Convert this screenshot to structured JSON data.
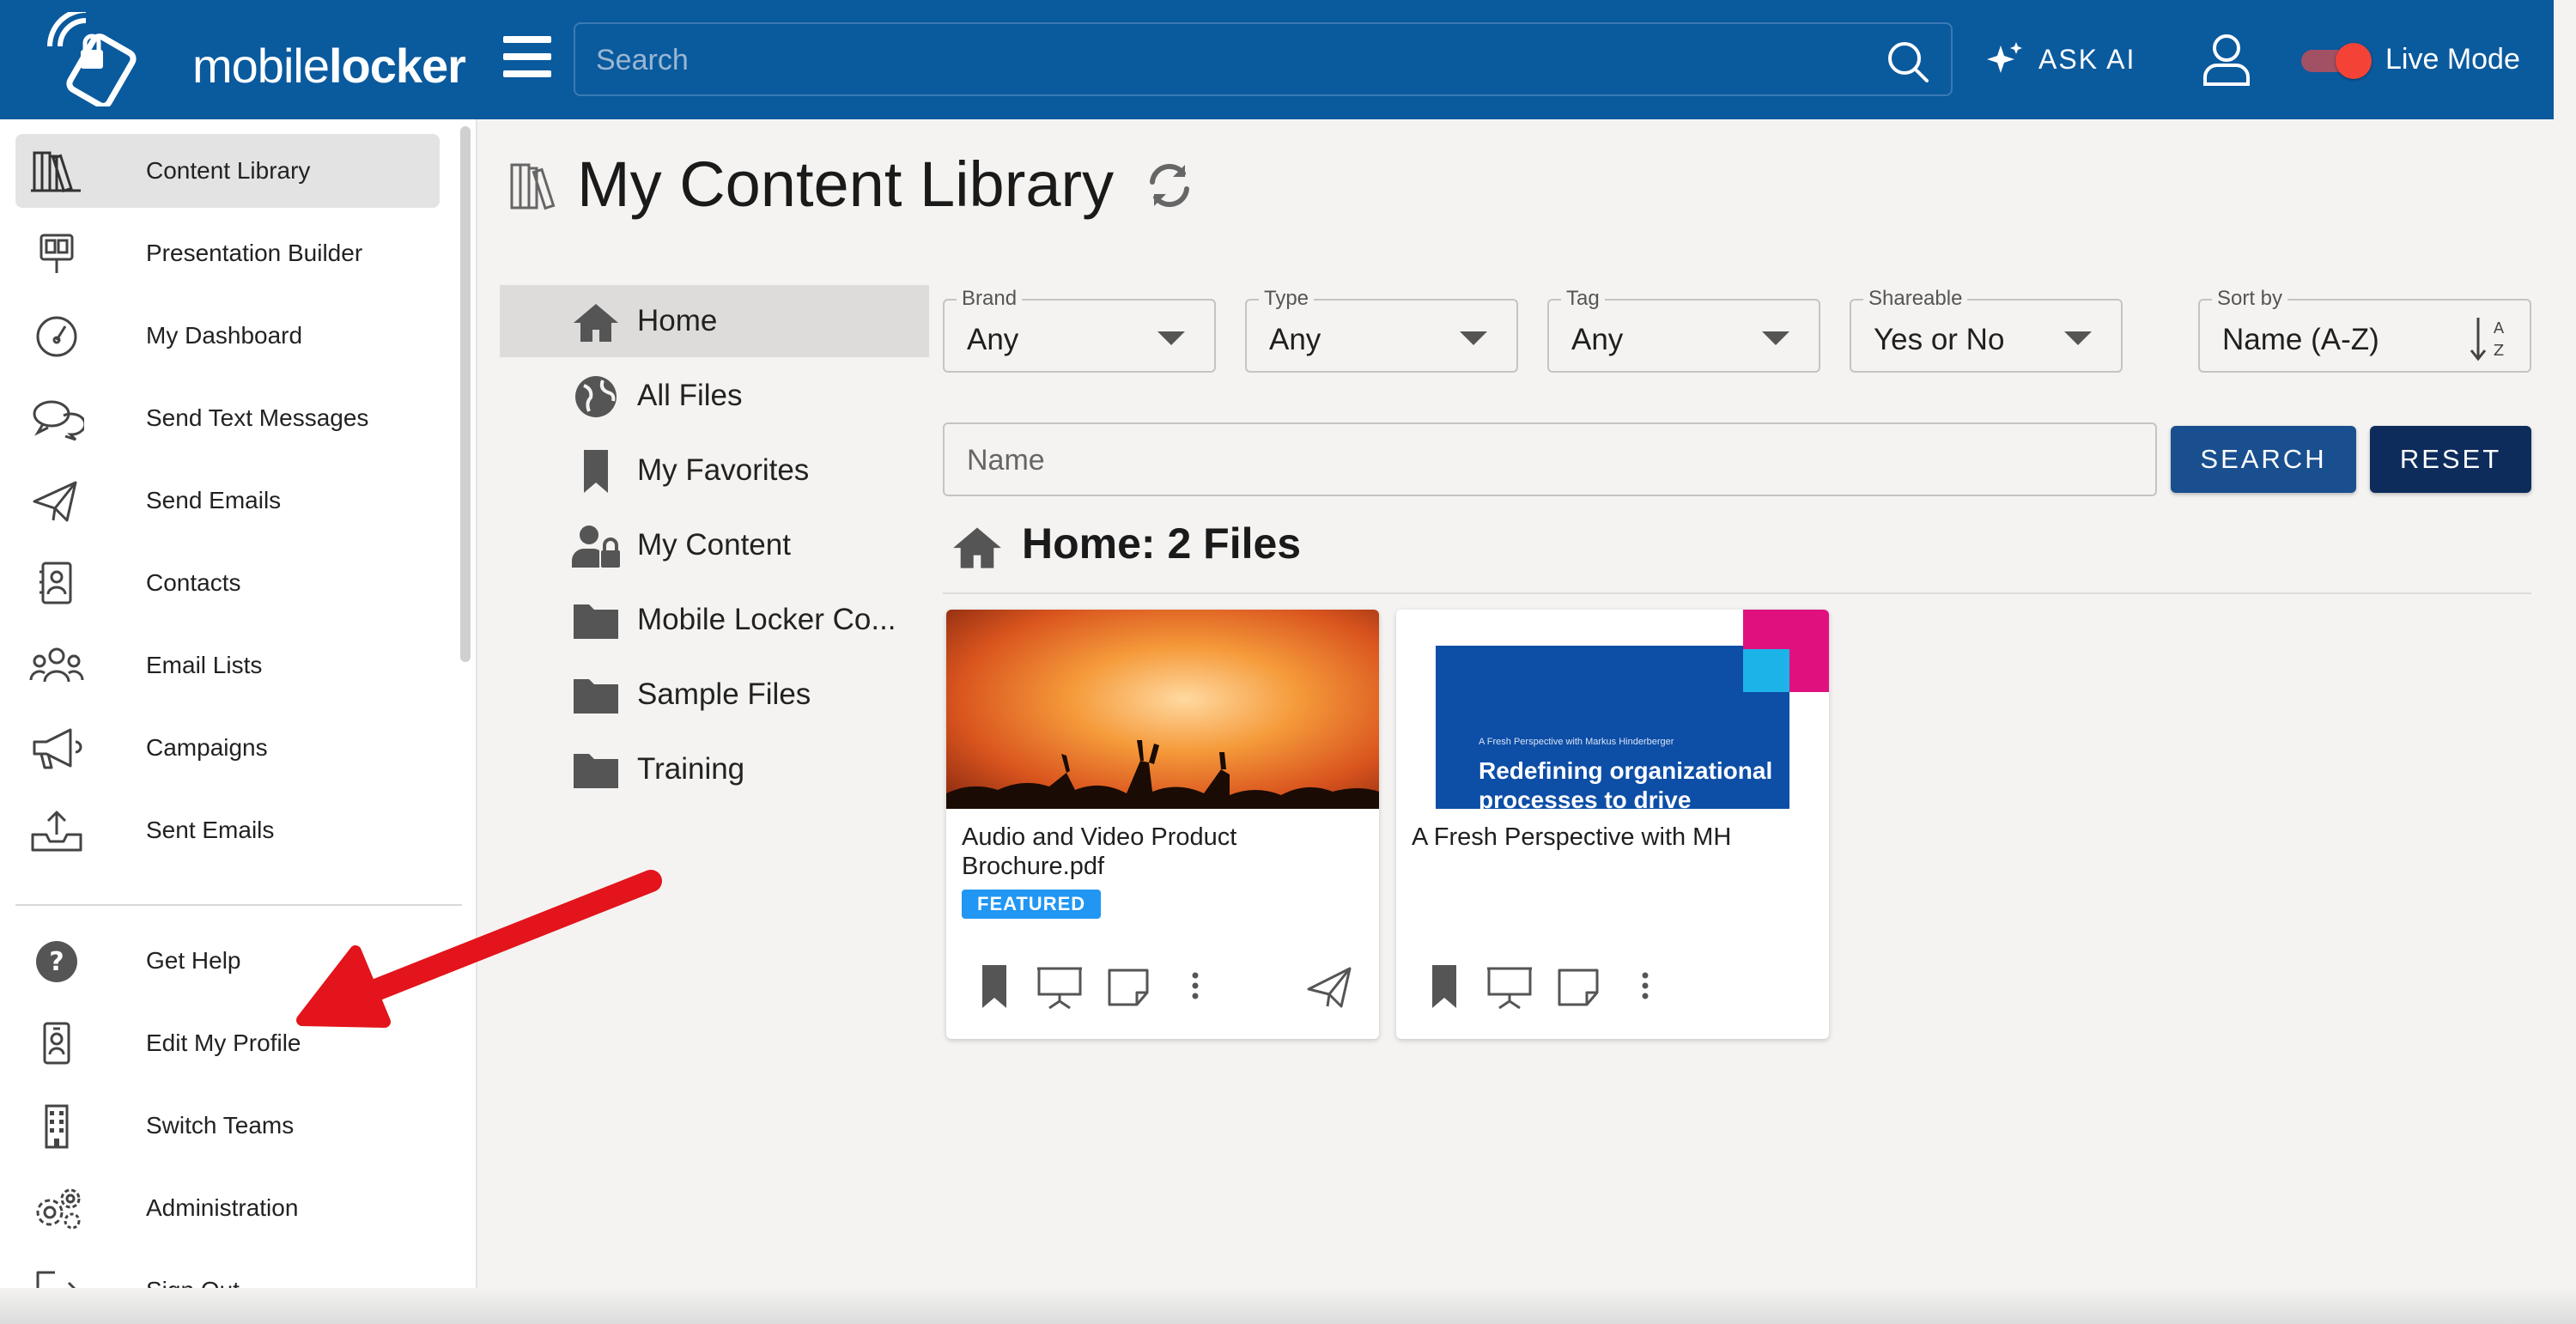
{
  "brand": {
    "logo_prefix": "mobile",
    "logo_suffix": "locker"
  },
  "topbar": {
    "search_placeholder": "Search",
    "ask_ai_label": "ASK AI",
    "live_mode_label": "Live Mode",
    "live_mode_on": true
  },
  "sidebar": {
    "items": [
      {
        "label": "Content Library",
        "icon": "books-icon",
        "active": true
      },
      {
        "label": "Presentation Builder",
        "icon": "presentation-builder-icon"
      },
      {
        "label": "My Dashboard",
        "icon": "dashboard-gauge-icon"
      },
      {
        "label": "Send Text Messages",
        "icon": "chat-bubbles-icon"
      },
      {
        "label": "Send Emails",
        "icon": "paper-plane-icon"
      },
      {
        "label": "Contacts",
        "icon": "contact-card-icon"
      },
      {
        "label": "Email Lists",
        "icon": "people-group-icon"
      },
      {
        "label": "Campaigns",
        "icon": "megaphone-icon"
      },
      {
        "label": "Sent Emails",
        "icon": "outbox-icon"
      }
    ],
    "bottom_items": [
      {
        "label": "Get Help",
        "icon": "help-circle-icon"
      },
      {
        "label": "Edit My Profile",
        "icon": "profile-badge-icon"
      },
      {
        "label": "Switch Teams",
        "icon": "building-icon"
      },
      {
        "label": "Administration",
        "icon": "gears-icon"
      },
      {
        "label": "Sign Out",
        "icon": "sign-out-icon"
      }
    ]
  },
  "main": {
    "title": "My Content Library",
    "folders": [
      {
        "label": "Home",
        "icon": "home-icon",
        "active": true
      },
      {
        "label": "All Files",
        "icon": "globe-icon"
      },
      {
        "label": "My Favorites",
        "icon": "bookmark-icon"
      },
      {
        "label": "My Content",
        "icon": "user-lock-icon"
      },
      {
        "label": "Mobile Locker Co...",
        "icon": "folder-icon"
      },
      {
        "label": "Sample Files",
        "icon": "folder-icon"
      },
      {
        "label": "Training",
        "icon": "folder-icon"
      }
    ],
    "filters": {
      "brand": {
        "label": "Brand",
        "value": "Any"
      },
      "type": {
        "label": "Type",
        "value": "Any"
      },
      "tag": {
        "label": "Tag",
        "value": "Any"
      },
      "shareable": {
        "label": "Shareable",
        "value": "Yes or No"
      },
      "sort": {
        "label": "Sort by",
        "value": "Name (A-Z)"
      }
    },
    "name_placeholder": "Name",
    "search_button": "SEARCH",
    "reset_button": "RESET",
    "section_title": "Home: 2 Files",
    "cards": [
      {
        "title": "Audio and Video Product Brochure.pdf",
        "badge": "FEATURED"
      },
      {
        "title": "A Fresh Perspective with MH",
        "thumb_caption": "A Fresh Perspective with Markus Hinderberger",
        "thumb_headline_1": "Redefining organizational",
        "thumb_headline_2": "processes to drive"
      }
    ]
  },
  "colors": {
    "topbar": "#0a5a9e",
    "search_button": "#1a4f8f",
    "reset_button": "#0d2c5c",
    "badge": "#2196f3",
    "live_toggle": "#f44336",
    "annotation_arrow": "#e3141b"
  }
}
